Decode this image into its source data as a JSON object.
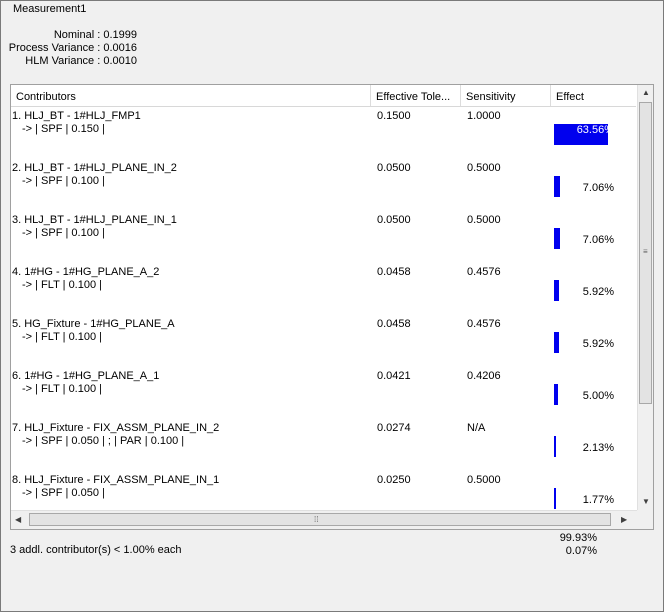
{
  "measurement_title": "Measurement1",
  "summary": {
    "nominal": "Nominal : 0.1999",
    "process_variance": "Process Variance : 0.0016",
    "hlm_variance": "HLM Variance : 0.0010"
  },
  "columns": {
    "contributors": "Contributors",
    "effective_tolerance": "Effective Tole...",
    "sensitivity": "Sensitivity",
    "effect": "Effect"
  },
  "rows": [
    {
      "name": "1. HLJ_BT - 1#HLJ_FMP1",
      "detail": "-> | SPF  | 0.150 |",
      "tolerance": "0.1500",
      "sensitivity": "1.0000",
      "effect": "63.56%",
      "effect_value": 63.56
    },
    {
      "name": "2. HLJ_BT - 1#HLJ_PLANE_IN_2",
      "detail": "-> | SPF  | 0.100 |",
      "tolerance": "0.0500",
      "sensitivity": "0.5000",
      "effect": "7.06%",
      "effect_value": 7.06
    },
    {
      "name": "3. HLJ_BT - 1#HLJ_PLANE_IN_1",
      "detail": "-> | SPF  | 0.100 |",
      "tolerance": "0.0500",
      "sensitivity": "0.5000",
      "effect": "7.06%",
      "effect_value": 7.06
    },
    {
      "name": "4. 1#HG - 1#HG_PLANE_A_2",
      "detail": "-> | FLT  | 0.100 |",
      "tolerance": "0.0458",
      "sensitivity": "0.4576",
      "effect": "5.92%",
      "effect_value": 5.92
    },
    {
      "name": "5. HG_Fixture - 1#HG_PLANE_A",
      "detail": "-> | FLT  | 0.100 |",
      "tolerance": "0.0458",
      "sensitivity": "0.4576",
      "effect": "5.92%",
      "effect_value": 5.92
    },
    {
      "name": "6. 1#HG - 1#HG_PLANE_A_1",
      "detail": "-> | FLT  | 0.100 |",
      "tolerance": "0.0421",
      "sensitivity": "0.4206",
      "effect": "5.00%",
      "effect_value": 5.0
    },
    {
      "name": "7. HLJ_Fixture - FIX_ASSM_PLANE_IN_2",
      "detail": "-> | SPF  | 0.050 | ;  | PAR  | 0.100 |",
      "tolerance": "0.0274",
      "sensitivity": "N/A",
      "effect": "2.13%",
      "effect_value": 2.13
    },
    {
      "name": "8. HLJ_Fixture - FIX_ASSM_PLANE_IN_1",
      "detail": "-> | SPF  | 0.050 |",
      "tolerance": "0.0250",
      "sensitivity": "0.5000",
      "effect": "1.77%",
      "effect_value": 1.77
    }
  ],
  "footer": {
    "additional": "3 addl. contributor(s) <  1.00% each",
    "total": "99.93%",
    "remainder": "0.07%"
  },
  "colors": {
    "bar": "#0000ee"
  }
}
